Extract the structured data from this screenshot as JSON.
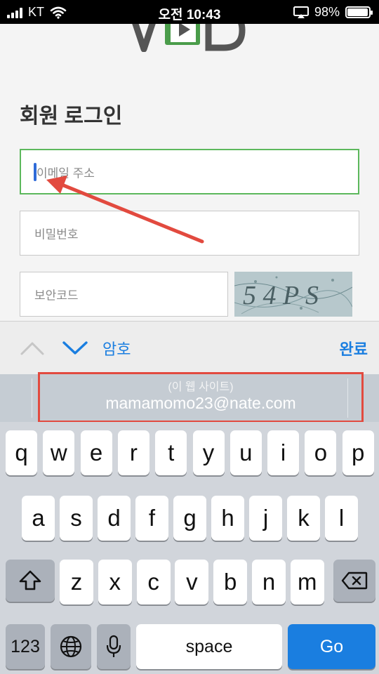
{
  "status_bar": {
    "carrier": "KT",
    "time": "오전 10:43",
    "battery": "98%",
    "battery_level": 0.98
  },
  "webpage": {
    "logo_text": "VD",
    "title": "회원 로그인",
    "email_placeholder": "이메일 주소",
    "password_placeholder": "비밀번호",
    "security_placeholder": "보안코드",
    "captcha_text": "5 4 P S"
  },
  "accessory_bar": {
    "password_label": "암호",
    "done_label": "완료"
  },
  "suggestion": {
    "sub_label": "(이 웹 사이트)",
    "email": "mamamomo23@nate.com"
  },
  "keyboard": {
    "row1": [
      "q",
      "w",
      "e",
      "r",
      "t",
      "y",
      "u",
      "i",
      "o",
      "p"
    ],
    "row2": [
      "a",
      "s",
      "d",
      "f",
      "g",
      "h",
      "j",
      "k",
      "l"
    ],
    "row3": [
      "z",
      "x",
      "c",
      "v",
      "b",
      "n",
      "m"
    ],
    "numbers_label": "123",
    "space_label": "space",
    "go_label": "Go"
  },
  "colors": {
    "accent_blue": "#1a7ee0",
    "focus_green": "#5cb85c",
    "annotation_red": "#e24a3f"
  }
}
